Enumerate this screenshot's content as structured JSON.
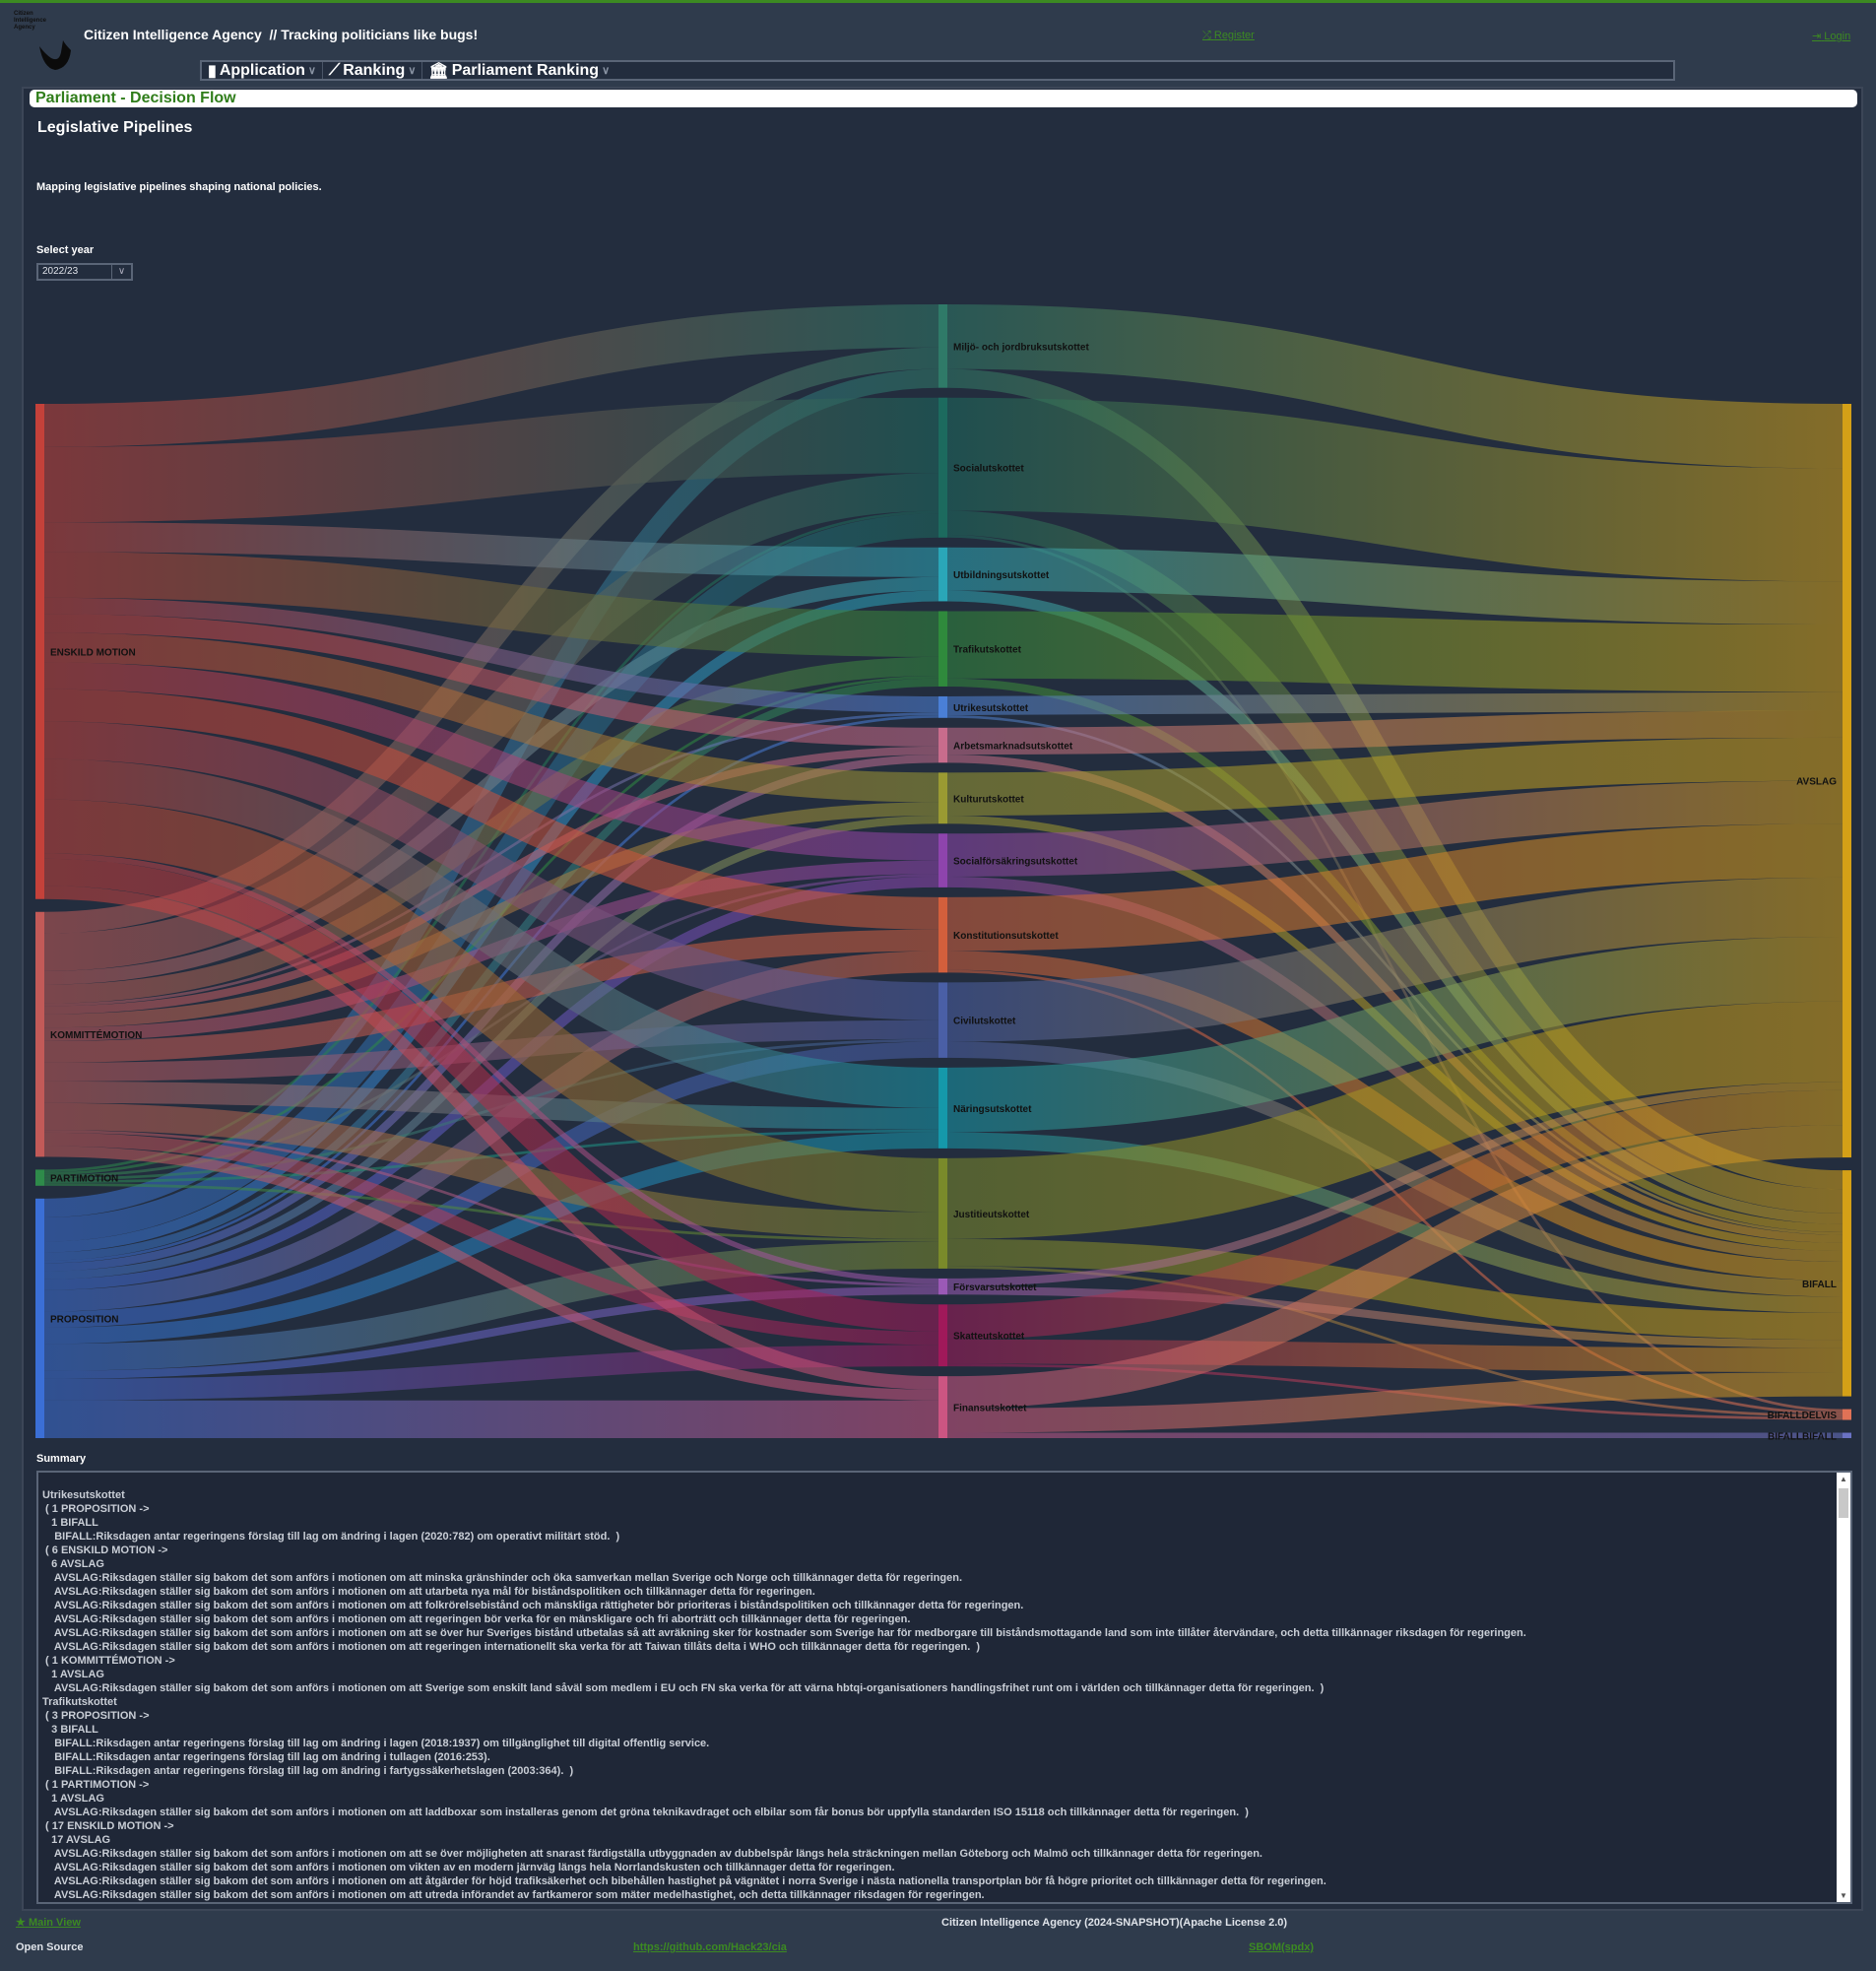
{
  "header": {
    "logo_text": "Citizen Intelligence Agency",
    "title": "Citizen Intelligence Agency  // Tracking politicians like bugs!",
    "register": "Register",
    "login": "Login"
  },
  "menu": [
    {
      "label": "Application",
      "icon": "server-icon"
    },
    {
      "label": "Ranking",
      "icon": "chart-line-icon"
    },
    {
      "label": "Parliament Ranking",
      "icon": "institution-icon"
    }
  ],
  "breadcrumb": "Parliament - Decision Flow",
  "page_title": "Legislative Pipelines",
  "description": "Mapping legislative pipelines shaping national policies.",
  "year_select": {
    "label": "Select year",
    "value": "2022/23"
  },
  "colors": {
    "accent": "#3c8a22",
    "header_bg": "#2f3b4c",
    "panel_bg": "#232d3e"
  },
  "chart_data": {
    "type": "sankey",
    "sources": [
      {
        "name": "ENSKILD MOTION",
        "color": "#c4413a"
      },
      {
        "name": "KOMMITTÉMOTION",
        "color": "#c25a58"
      },
      {
        "name": "PARTIMOTION",
        "color": "#2e8b4a"
      },
      {
        "name": "PROPOSITION",
        "color": "#3b6fd6"
      }
    ],
    "committees": [
      {
        "name": "Miljö- och jordbruksutskottet",
        "color": "#2f7a68",
        "from": [
          16,
          8,
          0,
          7
        ],
        "to": [
          24,
          7,
          0,
          0
        ]
      },
      {
        "name": "Socialutskottet",
        "color": "#1c6a5e",
        "from": [
          28,
          14,
          1,
          9
        ],
        "to": [
          42,
          9,
          1,
          0
        ]
      },
      {
        "name": "Utbildningsutskottet",
        "color": "#2aa6b8",
        "from": [
          11,
          5,
          0,
          4
        ],
        "to": [
          16,
          4,
          0,
          0
        ]
      },
      {
        "name": "Trafikutskottet",
        "color": "#2f8a3c",
        "from": [
          17,
          7,
          1,
          3
        ],
        "to": [
          25,
          3,
          0,
          0
        ]
      },
      {
        "name": "Utrikesutskottet",
        "color": "#4a7fd6",
        "from": [
          6,
          1,
          0,
          1
        ],
        "to": [
          7,
          1,
          0,
          0
        ]
      },
      {
        "name": "Arbetsmarknadsutskottet",
        "color": "#c86c8c",
        "from": [
          7,
          3,
          0,
          3
        ],
        "to": [
          10,
          3,
          0,
          0
        ]
      },
      {
        "name": "Kulturutskottet",
        "color": "#9a9a32",
        "from": [
          11,
          5,
          0,
          3
        ],
        "to": [
          16,
          3,
          0,
          0
        ]
      },
      {
        "name": "Socialförsäkringsutskottet",
        "color": "#8e44ad",
        "from": [
          10,
          5,
          1,
          4
        ],
        "to": [
          16,
          4,
          0,
          0
        ]
      },
      {
        "name": "Konstitutionsutskottet",
        "color": "#d35f3c",
        "from": [
          12,
          8,
          0,
          8
        ],
        "to": [
          20,
          7,
          1,
          0
        ]
      },
      {
        "name": "Civilutskottet",
        "color": "#4a5fa6",
        "from": [
          14,
          7,
          1,
          6
        ],
        "to": [
          22,
          6,
          0,
          0
        ]
      },
      {
        "name": "Näringsutskottet",
        "color": "#1598aa",
        "from": [
          15,
          8,
          1,
          6
        ],
        "to": [
          24,
          6,
          0,
          0
        ]
      },
      {
        "name": "Justitieutskottet",
        "color": "#7a8a2a",
        "from": [
          20,
          10,
          1,
          10
        ],
        "to": [
          30,
          10,
          1,
          0
        ]
      },
      {
        "name": "Försvarsutskottet",
        "color": "#9b59b6",
        "from": [
          2,
          1,
          0,
          3
        ],
        "to": [
          3,
          3,
          0,
          0
        ]
      },
      {
        "name": "Skatteutskottet",
        "color": "#a0195a",
        "from": [
          10,
          5,
          0,
          8
        ],
        "to": [
          13,
          9,
          1,
          0
        ]
      },
      {
        "name": "Finansutskottet",
        "color": "#cc5582",
        "from": [
          5,
          4,
          0,
          14
        ],
        "to": [
          12,
          9,
          0,
          2
        ]
      }
    ],
    "outcomes": [
      {
        "name": "AVSLAG",
        "color": "#d4a017"
      },
      {
        "name": "BIFALL",
        "color": "#d4a017"
      },
      {
        "name": "BIFALLDELVIS",
        "color": "#e07256"
      },
      {
        "name": "BIFALLBIFALL",
        "color": "#6a72c4"
      }
    ]
  },
  "summary": {
    "label": "Summary",
    "lines": [
      "Utrikesutskottet",
      " ( 1 PROPOSITION ->",
      "   1 BIFALL",
      "    BIFALL:Riksdagen antar regeringens förslag till lag om ändring i lagen (2020:782) om operativt militärt stöd.  )",
      " ( 6 ENSKILD MOTION ->",
      "   6 AVSLAG",
      "    AVSLAG:Riksdagen ställer sig bakom det som anförs i motionen om att minska gränshinder och öka samverkan mellan Sverige och Norge och tillkännager detta för regeringen.",
      "    AVSLAG:Riksdagen ställer sig bakom det som anförs i motionen om att utarbeta nya mål för biståndspolitiken och tillkännager detta för regeringen.",
      "    AVSLAG:Riksdagen ställer sig bakom det som anförs i motionen om att folkrörelsebistånd och mänskliga rättigheter bör prioriteras i biståndspolitiken och tillkännager detta för regeringen.",
      "    AVSLAG:Riksdagen ställer sig bakom det som anförs i motionen om att regeringen bör verka för en mänskligare och fri aborträtt och tillkännager detta för regeringen.",
      "    AVSLAG:Riksdagen ställer sig bakom det som anförs i motionen om att se över hur Sveriges bistånd utbetalas så att avräkning sker för kostnader som Sverige har för medborgare till biståndsmottagande land som inte tillåter återvändare, och detta tillkännager riksdagen för regeringen.",
      "    AVSLAG:Riksdagen ställer sig bakom det som anförs i motionen om att regeringen internationellt ska verka för att Taiwan tillåts delta i WHO och tillkännager detta för regeringen.  )",
      " ( 1 KOMMITTÉMOTION ->",
      "   1 AVSLAG",
      "    AVSLAG:Riksdagen ställer sig bakom det som anförs i motionen om att Sverige som enskilt land såväl som medlem i EU och FN ska verka för att värna hbtqi-organisationers handlingsfrihet runt om i världen och tillkännager detta för regeringen.  )",
      "Trafikutskottet",
      " ( 3 PROPOSITION ->",
      "   3 BIFALL",
      "    BIFALL:Riksdagen antar regeringens förslag till lag om ändring i lagen (2018:1937) om tillgänglighet till digital offentlig service.",
      "    BIFALL:Riksdagen antar regeringens förslag till lag om ändring i tullagen (2016:253).",
      "    BIFALL:Riksdagen antar regeringens förslag till lag om ändring i fartygssäkerhetslagen (2003:364).  )",
      " ( 1 PARTIMOTION ->",
      "   1 AVSLAG",
      "    AVSLAG:Riksdagen ställer sig bakom det som anförs i motionen om att laddboxar som installeras genom det gröna teknikavdraget och elbilar som får bonus bör uppfylla standarden ISO 15118 och tillkännager detta för regeringen.  )",
      " ( 17 ENSKILD MOTION ->",
      "   17 AVSLAG",
      "    AVSLAG:Riksdagen ställer sig bakom det som anförs i motionen om att se över möjligheten att snarast färdigställa utbyggnaden av dubbelspår längs hela sträckningen mellan Göteborg och Malmö och tillkännager detta för regeringen.",
      "    AVSLAG:Riksdagen ställer sig bakom det som anförs i motionen om vikten av en modern järnväg längs hela Norrlandskusten och tillkännager detta för regeringen.",
      "    AVSLAG:Riksdagen ställer sig bakom det som anförs i motionen om att åtgärder för höjd trafiksäkerhet och bibehållen hastighet på vägnätet i norra Sverige i nästa nationella transportplan bör få högre prioritet och tillkännager detta för regeringen.",
      "    AVSLAG:Riksdagen ställer sig bakom det som anförs i motionen om att utreda införandet av fartkameror som mäter medelhastighet, och detta tillkännager riksdagen för regeringen."
    ]
  },
  "footer": {
    "main_view": "Main View",
    "license": "Citizen Intelligence Agency (2024-SNAPSHOT)(Apache License 2.0)",
    "open_source": "Open Source",
    "github": "https://github.com/Hack23/cia",
    "sbom": "SBOM(spdx)"
  }
}
